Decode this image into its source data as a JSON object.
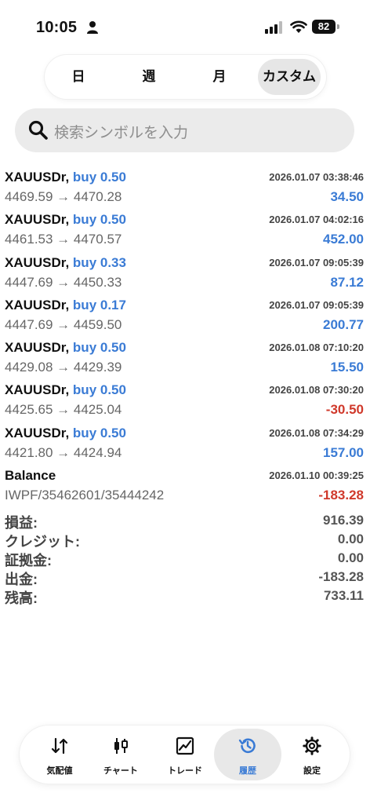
{
  "status_bar": {
    "time": "10:05",
    "battery": "82"
  },
  "period_tabs": [
    {
      "label": "日"
    },
    {
      "label": "週"
    },
    {
      "label": "月"
    },
    {
      "label": "カスタム"
    }
  ],
  "search": {
    "placeholder": "検索シンボルを入力"
  },
  "deals": [
    {
      "symbol": "XAUUSDr,",
      "type": "buy 0.50",
      "date": "2026.01.07 03:38:46",
      "prices": "4469.59 → 4470.28",
      "profit": "34.50"
    },
    {
      "symbol": "XAUUSDr,",
      "type": "buy 0.50",
      "date": "2026.01.07 04:02:16",
      "prices": "4461.53 → 4470.57",
      "profit": "452.00"
    },
    {
      "symbol": "XAUUSDr,",
      "type": "buy 0.33",
      "date": "2026.01.07 09:05:39",
      "prices": "4447.69 → 4450.33",
      "profit": "87.12"
    },
    {
      "symbol": "XAUUSDr,",
      "type": "buy 0.17",
      "date": "2026.01.07 09:05:39",
      "prices": "4447.69 → 4459.50",
      "profit": "200.77"
    },
    {
      "symbol": "XAUUSDr,",
      "type": "buy 0.50",
      "date": "2026.01.08 07:10:20",
      "prices": "4429.08 → 4429.39",
      "profit": "15.50"
    },
    {
      "symbol": "XAUUSDr,",
      "type": "buy 0.50",
      "date": "2026.01.08 07:30:20",
      "prices": "4425.65 → 4425.04",
      "profit": "-30.50"
    },
    {
      "symbol": "XAUUSDr,",
      "type": "buy 0.50",
      "date": "2026.01.08 07:34:29",
      "prices": "4421.80 → 4424.94",
      "profit": "157.00"
    },
    {
      "symbol": "Balance",
      "type": "",
      "date": "2026.01.10 00:39:25",
      "prices": "IWPF/35462601/35444242",
      "profit": "-183.28"
    }
  ],
  "summary": [
    {
      "label": "損益:",
      "value": "916.39"
    },
    {
      "label": "クレジット:",
      "value": "0.00"
    },
    {
      "label": "証拠金:",
      "value": "0.00"
    },
    {
      "label": "出金:",
      "value": "-183.28"
    },
    {
      "label": "残高:",
      "value": "733.11"
    }
  ],
  "bottom_nav": [
    {
      "label": "気配値",
      "icon": "quotes-arrows-icon"
    },
    {
      "label": "チャート",
      "icon": "candlestick-chart-icon"
    },
    {
      "label": "トレード",
      "icon": "trade-line-chart-icon"
    },
    {
      "label": "履歴",
      "icon": "history-clock-icon",
      "active": true
    },
    {
      "label": "設定",
      "icon": "settings-gear-icon"
    }
  ],
  "colors": {
    "accent": "#3a7bd5",
    "negative": "#d0392b"
  }
}
